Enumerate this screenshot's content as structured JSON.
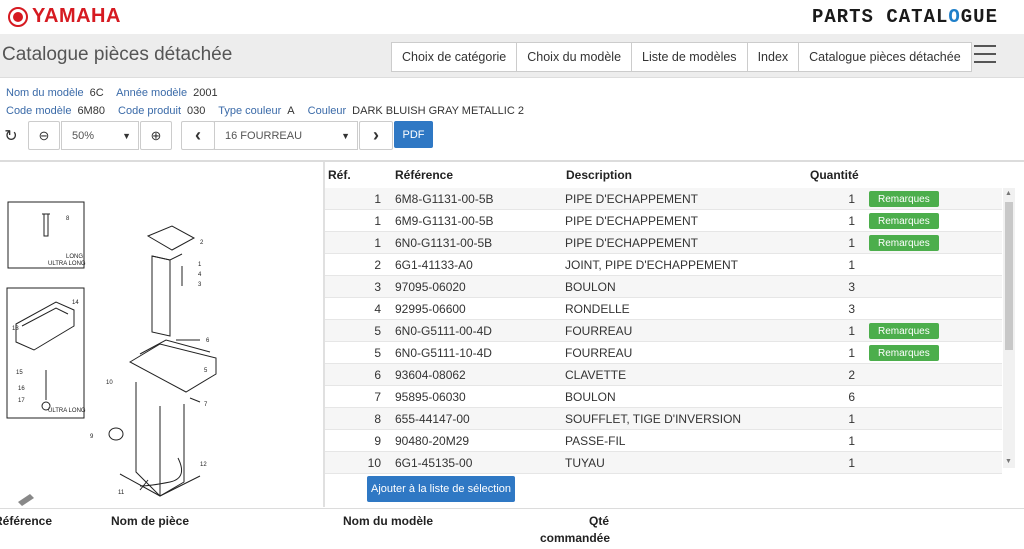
{
  "brand": {
    "name": "YAMAHA",
    "catalogue_logo_a": "PARTS CATAL",
    "catalogue_logo_gear": "O",
    "catalogue_logo_b": "GUE"
  },
  "nav": {
    "title": "Catalogue pièces détachée",
    "tabs": [
      "Choix de catégorie",
      "Choix du modèle",
      "Liste de modèles",
      "Index",
      "Catalogue pièces détachée"
    ]
  },
  "model_info": {
    "nom_label": "Nom du modèle",
    "nom_value": "6C",
    "annee_label": "Année modèle",
    "annee_value": "2001",
    "code_label": "Code modèle",
    "code_value": "6M80",
    "produit_label": "Code produit",
    "produit_value": "030",
    "type_label": "Type couleur",
    "type_value": "A",
    "couleur_label": "Couleur",
    "couleur_value": "DARK BLUISH GRAY METALLIC 2"
  },
  "toolbar": {
    "refresh_icon": "↻",
    "zoom_out_icon": "⊖",
    "zoom_value": "50%",
    "zoom_in_icon": "⊕",
    "prev_icon": "‹",
    "category_value": "16 FOURREAU",
    "next_icon": "›",
    "pdf_label": "PDF"
  },
  "table": {
    "headers": {
      "ref": "Réf.",
      "reference": "Référence",
      "description": "Description",
      "quantite": "Quantité"
    },
    "remark_label": "Remarques",
    "rows": [
      {
        "ref": "1",
        "part": "6M8-G1131-00-5B",
        "desc": "PIPE D'ECHAPPEMENT",
        "qty": "1",
        "remark": true
      },
      {
        "ref": "1",
        "part": "6M9-G1131-00-5B",
        "desc": "PIPE D'ECHAPPEMENT",
        "qty": "1",
        "remark": true
      },
      {
        "ref": "1",
        "part": "6N0-G1131-00-5B",
        "desc": "PIPE D'ECHAPPEMENT",
        "qty": "1",
        "remark": true
      },
      {
        "ref": "2",
        "part": "6G1-41133-A0",
        "desc": "JOINT, PIPE D'ECHAPPEMENT",
        "qty": "1",
        "remark": false
      },
      {
        "ref": "3",
        "part": "97095-06020",
        "desc": "BOULON",
        "qty": "3",
        "remark": false
      },
      {
        "ref": "4",
        "part": "92995-06600",
        "desc": "RONDELLE",
        "qty": "3",
        "remark": false
      },
      {
        "ref": "5",
        "part": "6N0-G5111-00-4D",
        "desc": "FOURREAU",
        "qty": "1",
        "remark": true
      },
      {
        "ref": "5",
        "part": "6N0-G5111-10-4D",
        "desc": "FOURREAU",
        "qty": "1",
        "remark": true
      },
      {
        "ref": "6",
        "part": "93604-08062",
        "desc": "CLAVETTE",
        "qty": "2",
        "remark": false
      },
      {
        "ref": "7",
        "part": "95895-06030",
        "desc": "BOULON",
        "qty": "6",
        "remark": false
      },
      {
        "ref": "8",
        "part": "655-44147-00",
        "desc": "SOUFFLET, TIGE D'INVERSION",
        "qty": "1",
        "remark": false
      },
      {
        "ref": "9",
        "part": "90480-20M29",
        "desc": "PASSE-FIL",
        "qty": "1",
        "remark": false
      },
      {
        "ref": "10",
        "part": "6G1-45135-00",
        "desc": "TUYAU",
        "qty": "1",
        "remark": false
      }
    ]
  },
  "add_button": "Ajouter à la liste de sélection",
  "diagram_labels": {
    "long": "LONG",
    "ultra_long": "ULTRA LONG",
    "callouts": [
      "1",
      "2",
      "3",
      "4",
      "5",
      "6",
      "7",
      "8",
      "9",
      "10",
      "11",
      "12",
      "13",
      "14",
      "15",
      "16",
      "17"
    ]
  },
  "selection_headers": {
    "reference": "Référence",
    "nom_piece": "Nom de pièce",
    "nom_modele": "Nom du modèle",
    "qte_1": "Qté",
    "qte_2": "commandée"
  }
}
